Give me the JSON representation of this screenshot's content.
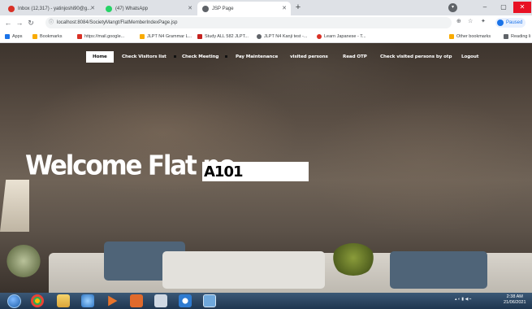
{
  "browser": {
    "tabs": [
      {
        "label": "Inbox (12,317) - yatinjoshi90@g...",
        "icon_color": "#d93025",
        "active": false
      },
      {
        "label": "(47) WhatsApp",
        "icon_color": "#25d366",
        "active": false
      },
      {
        "label": "JSP Page",
        "icon_color": "#5f6368",
        "active": true
      }
    ],
    "new_tab": "+",
    "url": "localhost:8084/SocietyMangt/FlatMemberIndexPage.jsp",
    "profile_label": "Paused",
    "bookmarks": [
      {
        "label": "Apps",
        "icon_color": "#1a73e8"
      },
      {
        "label": "Bookmarks",
        "icon_color": "#f9ab00"
      },
      {
        "label": "https://mail.google...",
        "icon_color": "#d93025"
      },
      {
        "label": "JLPT N4 Grammar L...",
        "icon_color": "#f9ab00"
      },
      {
        "label": "Study ALL 582 JLPT...",
        "icon_color": "#c5221f"
      },
      {
        "label": "JLPT N4 Kanji test -...",
        "icon_color": "#5f6368"
      },
      {
        "label": "Learn Japanese - T...",
        "icon_color": "#d93025"
      }
    ],
    "other_bookmarks": "Other bookmarks",
    "reading_list": "Reading li"
  },
  "nav": {
    "home": "Home",
    "check_visitors": "Check Visitors list",
    "check_meeting": "Check Meeting",
    "pay_maintenance": "Pay Maintenance",
    "visited_persons": "visited persons",
    "read_otp": "Read OTP",
    "check_visited_by_otp": "Check visited persons by otp",
    "logout": "Logout"
  },
  "welcome": {
    "text": "Welcome Flat no",
    "flat_no": "A101"
  },
  "taskbar": {
    "clock_time": "2:38 AM",
    "clock_date": "21/06/2021"
  },
  "colors": {
    "active_nav_bg": "#ffffff",
    "taskbar": "#2a4460",
    "chrome_tabstrip": "#dee1e6"
  }
}
